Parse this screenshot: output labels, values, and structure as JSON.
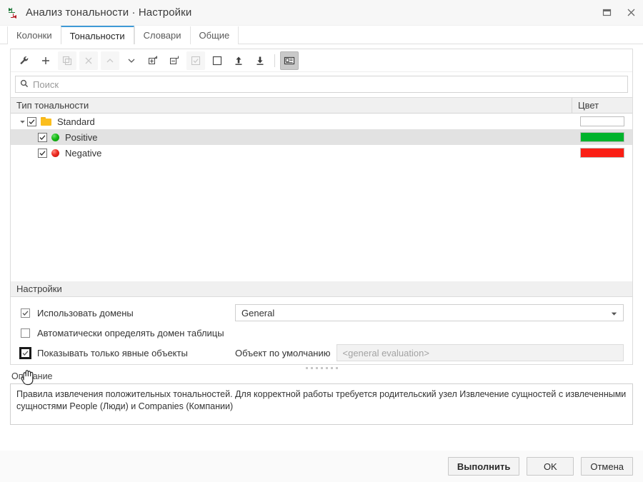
{
  "window": {
    "title": "Анализ тональности · Настройки",
    "app_icon": "sentiment-arrows-icon",
    "controls": {
      "maximize": "maximize-icon",
      "close": "close-icon"
    }
  },
  "tabs": [
    {
      "label": "Колонки",
      "active": false
    },
    {
      "label": "Тональности",
      "active": true
    },
    {
      "label": "Словари",
      "active": false
    },
    {
      "label": "Общие",
      "active": false
    }
  ],
  "toolbar": {
    "buttons": [
      {
        "name": "settings-wrench-icon",
        "state": "enabled"
      },
      {
        "name": "add-icon",
        "state": "enabled"
      },
      {
        "name": "copy-icon",
        "state": "disabled"
      },
      {
        "name": "delete-icon",
        "state": "disabled"
      },
      {
        "name": "move-up-icon",
        "state": "disabled"
      },
      {
        "name": "move-down-icon",
        "state": "enabled"
      },
      {
        "name": "expand-all-icon",
        "state": "enabled"
      },
      {
        "name": "collapse-all-icon",
        "state": "enabled"
      },
      {
        "name": "check-all-icon",
        "state": "disabled"
      },
      {
        "name": "uncheck-all-icon",
        "state": "enabled"
      },
      {
        "name": "import-icon",
        "state": "enabled"
      },
      {
        "name": "export-icon",
        "state": "enabled"
      },
      {
        "name": "details-view-icon",
        "state": "pressed"
      }
    ]
  },
  "search": {
    "placeholder": "Поиск",
    "value": "",
    "icon": "search-icon"
  },
  "table": {
    "columns": [
      "Тип тональности",
      "Цвет"
    ],
    "rows": [
      {
        "label": "Standard",
        "level": 0,
        "checked": true,
        "expanded": true,
        "icon": "folder-icon",
        "color": "",
        "selected": false
      },
      {
        "label": "Positive",
        "level": 1,
        "checked": true,
        "icon": "green-circle-icon",
        "color": "#00b32c",
        "selected": true
      },
      {
        "label": "Negative",
        "level": 1,
        "checked": true,
        "icon": "red-circle-icon",
        "color": "#fa1e14",
        "selected": false
      }
    ]
  },
  "settings": {
    "title": "Настройки",
    "use_domains": {
      "label": "Использовать домены",
      "checked": true
    },
    "domain_select": {
      "value": "General"
    },
    "auto_domain": {
      "label": "Автоматически определять домен таблицы",
      "checked": false
    },
    "explicit_objects": {
      "label": "Показывать только явные объекты",
      "checked": true,
      "focused": true
    },
    "default_object": {
      "label": "Объект по умолчанию",
      "value": "<general evaluation>",
      "disabled": true
    }
  },
  "description": {
    "label": "Описание",
    "text": "Правила извлечения положительных тональностей. Для корректной работы требуется родительский узел Извлечение сущностей с извлеченными сущностями People (Люди) и Companies (Компании)"
  },
  "footer": {
    "run_label": "Выполнить",
    "ok_label": "OK",
    "cancel_label": "Отмена"
  }
}
